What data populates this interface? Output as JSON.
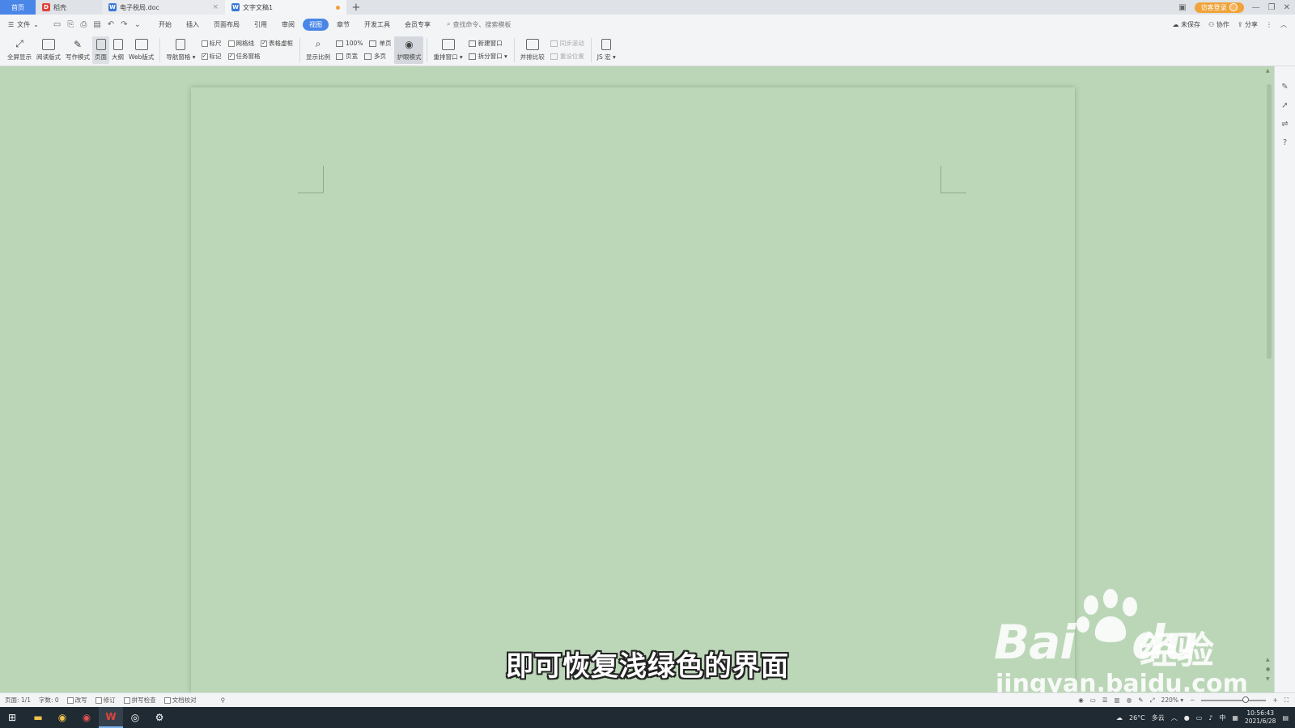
{
  "tabs": [
    {
      "label": "首页",
      "logo": ""
    },
    {
      "label": "稻壳",
      "logo": "D"
    },
    {
      "label": "电子税局.doc",
      "logo": "W"
    },
    {
      "label": "文字文稿1",
      "logo": "W"
    }
  ],
  "titlebar": {
    "new_tab": "+",
    "login_label": "访客登录",
    "min": "—",
    "restore": "❐",
    "close": "✕"
  },
  "menu": {
    "file_label": "文件",
    "items": [
      "开始",
      "插入",
      "页面布局",
      "引用",
      "审阅",
      "视图",
      "章节",
      "开发工具",
      "会员专享"
    ],
    "search_placeholder": "查找命令、搜索模板",
    "unsaved": "未保存",
    "collab": "协作",
    "share": "分享"
  },
  "ribbon": {
    "fullscreen": "全屏显示",
    "read_mode": "阅读版式",
    "write_mode": "写作模式",
    "page_view": "页面",
    "outline": "大纲",
    "web_view": "Web版式",
    "nav_pane": "导航窗格",
    "ruler": "标尺",
    "gridlines": "网格线",
    "table_gridlines": "表格虚框",
    "marks": "标记",
    "task_pane": "任务窗格",
    "zoom": "显示比例",
    "zoom_100": "100%",
    "single_page": "单页",
    "page_width": "页宽",
    "multi_page": "多页",
    "eye_mode": "护眼模式",
    "rearrange": "重排窗口",
    "new_window": "新建窗口",
    "split_window": "拆分窗口",
    "side_by_side": "并排比较",
    "sync_scroll": "同步滚动",
    "reset_pos": "重设位置",
    "js_macro": "JS 宏"
  },
  "subtitle": "即可恢复浅绿色的界面",
  "watermark": {
    "brand": "Bai",
    "brand_du": "du",
    "jingyan": "经验",
    "url": "jingyan.baidu.com"
  },
  "status": {
    "pages": "页面: 1/1",
    "words": "字数: 0",
    "overwrite": "改写",
    "revise": "修订",
    "spellcheck": "拼写检查",
    "doc_check": "文档校对",
    "zoom": "220%",
    "zoom_minus": "−",
    "zoom_plus": "+",
    "zoom_level": 0.68
  },
  "taskbar": {
    "temperature": "26°C",
    "weather": "多云",
    "ime": "中",
    "time": "10:56:43",
    "date": "2021/6/28"
  },
  "colors": {
    "eye_green": "#bad6b7",
    "accent": "#4a86e8",
    "login": "#f0a33a"
  }
}
